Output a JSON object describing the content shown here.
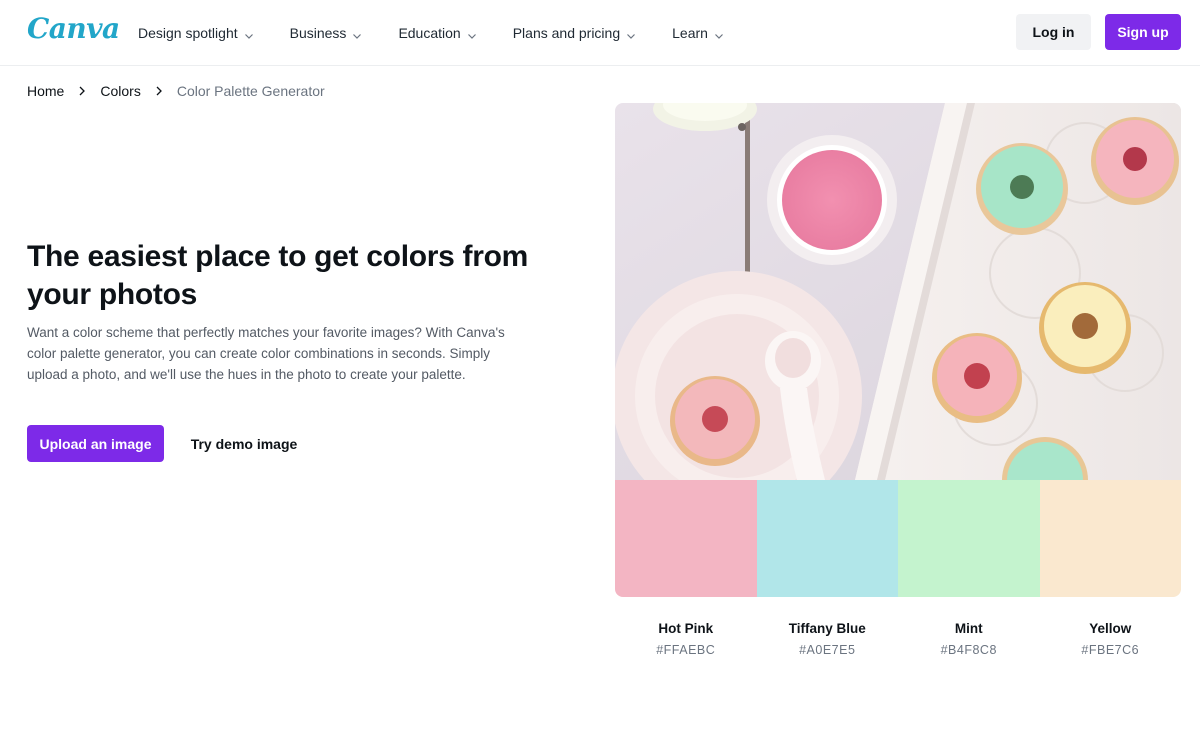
{
  "header": {
    "logo": "Canva",
    "nav": [
      {
        "label": "Design spotlight"
      },
      {
        "label": "Business"
      },
      {
        "label": "Education"
      },
      {
        "label": "Plans and pricing"
      },
      {
        "label": "Learn"
      }
    ],
    "login_label": "Log in",
    "signup_label": "Sign up"
  },
  "breadcrumb": {
    "items": [
      "Home",
      "Colors",
      "Color Palette Generator"
    ]
  },
  "hero": {
    "title": "The easiest place to get colors from your photos",
    "description": "Want a color scheme that perfectly matches your favorite images? With Canva's color palette generator, you can create color combinations in seconds. Simply upload a photo, and we'll use the hues in the photo to create your palette.",
    "upload_label": "Upload an image",
    "demo_label": "Try demo image"
  },
  "palette": [
    {
      "name": "Hot Pink",
      "hex": "#FFAEBC",
      "display": "#F3B5C3"
    },
    {
      "name": "Tiffany Blue",
      "hex": "#A0E7E5",
      "display": "#B1E6E9"
    },
    {
      "name": "Mint",
      "hex": "#B4F8C8",
      "display": "#C4F3CE"
    },
    {
      "name": "Yellow",
      "hex": "#FBE7C6",
      "display": "#FAE8CF"
    }
  ],
  "colors": {
    "brand_purple": "#7D2AE8",
    "logo_teal": "#22A6C9"
  },
  "icons": {
    "nav_dropdown": "chevron-down-icon",
    "breadcrumb_separator": "chevron-right-icon"
  }
}
